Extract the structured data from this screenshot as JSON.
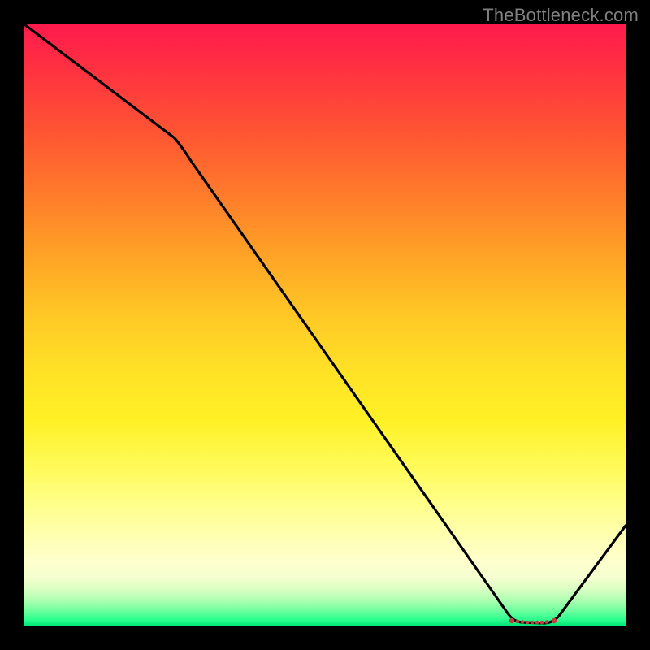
{
  "watermark": "TheBottleneck.com",
  "chart_data": {
    "type": "line",
    "title": "",
    "xlabel": "",
    "ylabel": "",
    "x": [
      0,
      25,
      81,
      88,
      100
    ],
    "values": [
      100,
      81,
      0,
      0,
      15
    ],
    "xlim": [
      0,
      100
    ],
    "ylim": [
      0,
      100
    ],
    "background_gradient": {
      "top": "#ff1a4d",
      "mid": "#fff126",
      "bottom": "#00e676"
    },
    "flat_segment_x": [
      81,
      88
    ]
  }
}
